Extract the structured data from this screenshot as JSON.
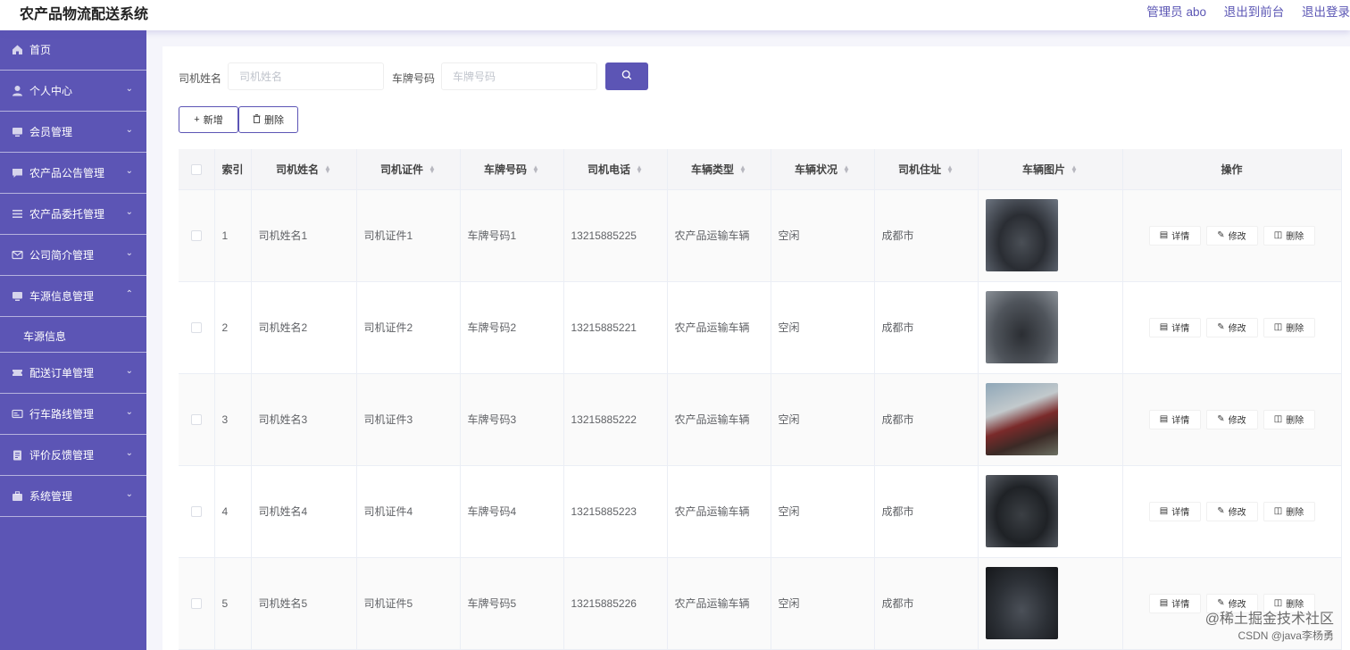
{
  "app": {
    "title": "农产品物流配送系统"
  },
  "header": {
    "user": "管理员 abo",
    "back_to_front": "退出到前台",
    "logout": "退出登录"
  },
  "sidebar": {
    "items": [
      {
        "label": "首页",
        "icon": "home-icon",
        "expandable": false
      },
      {
        "label": "个人中心",
        "icon": "user-icon",
        "expandable": true
      },
      {
        "label": "会员管理",
        "icon": "member-icon",
        "expandable": true
      },
      {
        "label": "农产品公告管理",
        "icon": "notice-icon",
        "expandable": true
      },
      {
        "label": "农产品委托管理",
        "icon": "list-icon",
        "expandable": true
      },
      {
        "label": "公司简介管理",
        "icon": "mail-icon",
        "expandable": true
      },
      {
        "label": "车源信息管理",
        "icon": "monitor-icon",
        "expandable": true,
        "expanded": true
      },
      {
        "label": "配送订单管理",
        "icon": "ticket-icon",
        "expandable": true
      },
      {
        "label": "行车路线管理",
        "icon": "card-icon",
        "expandable": true
      },
      {
        "label": "评价反馈管理",
        "icon": "clipboard-icon",
        "expandable": true
      },
      {
        "label": "系统管理",
        "icon": "briefcase-icon",
        "expandable": true
      }
    ],
    "subitem": "车源信息"
  },
  "search": {
    "driver_label": "司机姓名",
    "driver_placeholder": "司机姓名",
    "plate_label": "车牌号码",
    "plate_placeholder": "车牌号码"
  },
  "actions": {
    "add": "新增",
    "delete": "删除"
  },
  "table": {
    "columns": [
      "索引",
      "司机姓名",
      "司机证件",
      "车牌号码",
      "司机电话",
      "车辆类型",
      "车辆状况",
      "司机住址",
      "车辆图片",
      "操作"
    ],
    "rows": [
      {
        "index": "1",
        "name": "司机姓名1",
        "license": "司机证件1",
        "plate": "车牌号码1",
        "phone": "13215885225",
        "type": "农产品运输车辆",
        "status": "空闲",
        "address": "成都市"
      },
      {
        "index": "2",
        "name": "司机姓名2",
        "license": "司机证件2",
        "plate": "车牌号码2",
        "phone": "13215885221",
        "type": "农产品运输车辆",
        "status": "空闲",
        "address": "成都市"
      },
      {
        "index": "3",
        "name": "司机姓名3",
        "license": "司机证件3",
        "plate": "车牌号码3",
        "phone": "13215885222",
        "type": "农产品运输车辆",
        "status": "空闲",
        "address": "成都市"
      },
      {
        "index": "4",
        "name": "司机姓名4",
        "license": "司机证件4",
        "plate": "车牌号码4",
        "phone": "13215885223",
        "type": "农产品运输车辆",
        "status": "空闲",
        "address": "成都市"
      },
      {
        "index": "5",
        "name": "司机姓名5",
        "license": "司机证件5",
        "plate": "车牌号码5",
        "phone": "13215885226",
        "type": "农产品运输车辆",
        "status": "空闲",
        "address": "成都市"
      }
    ],
    "ops": {
      "detail": "详情",
      "edit": "修改",
      "delete": "删除"
    }
  },
  "watermark": {
    "line1": "@稀土掘金技术社区",
    "line2": "CSDN @java李杨勇"
  },
  "colors": {
    "accent": "#5c55b5",
    "header_link": "#5b56b4",
    "table_header_bg": "#f5f5f7"
  }
}
